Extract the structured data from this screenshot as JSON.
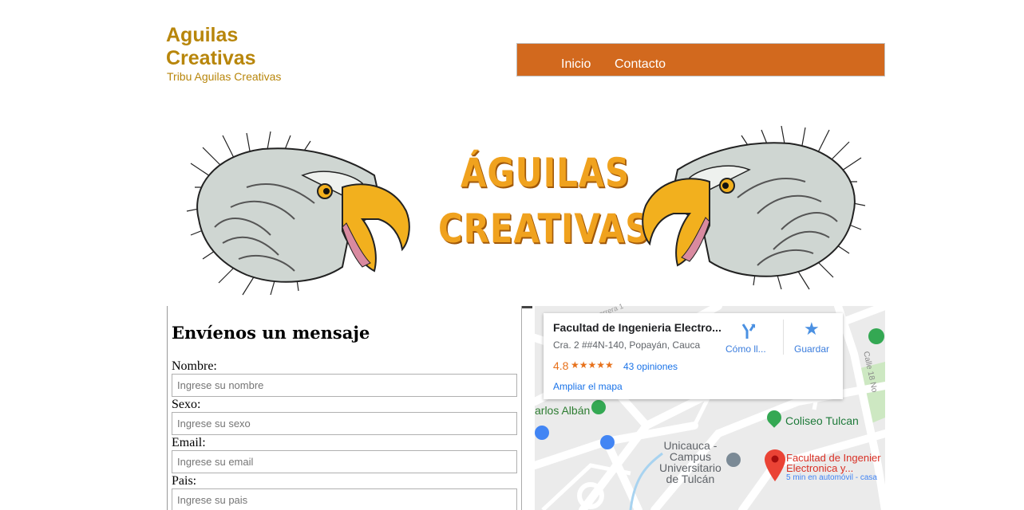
{
  "header": {
    "site_title": "Aguilas Creativas",
    "tagline": "Tribu Aguilas Creativas"
  },
  "nav": {
    "items": [
      {
        "label": "Inicio"
      },
      {
        "label": "Contacto"
      }
    ],
    "background": "#d2691e"
  },
  "banner": {
    "line1": "ÁGUILAS",
    "line2": "CREATIVAS"
  },
  "form": {
    "heading": "Envíenos un mensaje",
    "fields": [
      {
        "label": "Nombre:",
        "placeholder": "Ingrese su nombre"
      },
      {
        "label": "Sexo:",
        "placeholder": "Ingrese su sexo"
      },
      {
        "label": "Email:",
        "placeholder": "Ingrese su email"
      },
      {
        "label": "Pais:",
        "placeholder": "Ingrese su pais"
      }
    ]
  },
  "map": {
    "place_name": "Facultad de Ingenieria Electro...",
    "address": "Cra. 2 ##4N-140, Popayán, Cauca",
    "rating": "4.8",
    "stars": "★★★★★",
    "reviews": "43 opiniones",
    "enlarge": "Ampliar el mapa",
    "directions": "Cómo ll...",
    "save": "Guardar",
    "labels": {
      "carlos_alban": "arlos Albán",
      "coliseo": "Coliseo Tulcan",
      "campus": "Unicauca -\nCampus\nUniversitario\nde Tulcán",
      "marker_title": "Facultad de Ingenier\nElectronica y...",
      "marker_sub": "5 min en automóvil - casa",
      "street_18": "Calle 18 No",
      "street_top": "arrera 1"
    }
  },
  "colors": {
    "gold": "#b8860b",
    "orange_nav": "#d2691e",
    "banner_text": "#f0a21e",
    "map_link": "#1a73e8",
    "rating": "#e7711b"
  }
}
